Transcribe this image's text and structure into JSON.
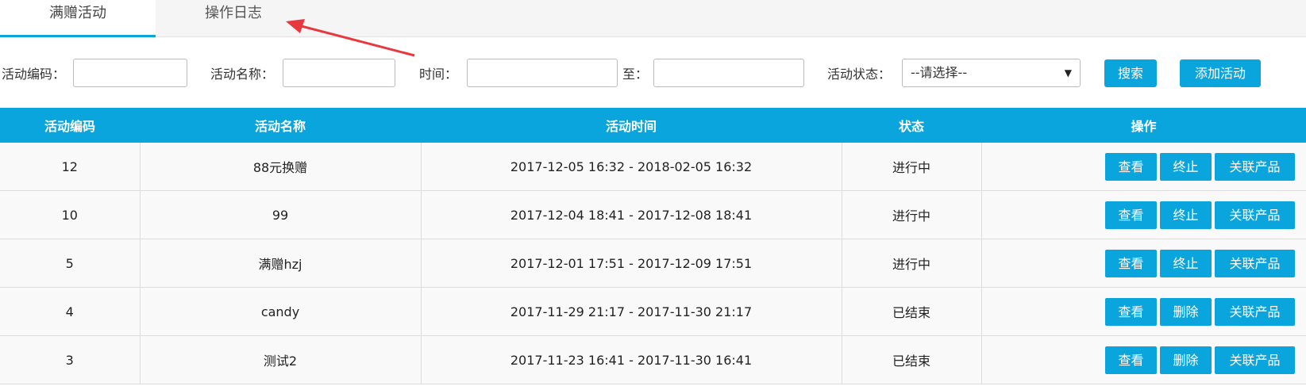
{
  "tabs": [
    {
      "label": "满赠活动",
      "active": true
    },
    {
      "label": "操作日志",
      "active": false
    }
  ],
  "filters": {
    "code_label": "活动编码：",
    "name_label": "活动名称：",
    "time_label": "时间：",
    "to_label": "至：",
    "status_label": "活动状态：",
    "status_selected": "--请选择--",
    "search_button": "搜索",
    "add_button": "添加活动"
  },
  "table": {
    "headers": [
      "活动编码",
      "活动名称",
      "活动时间",
      "状态",
      "操作"
    ],
    "rows": [
      {
        "code": "12",
        "name": "88元换赠",
        "time": "2017-12-05 16:32 - 2018-02-05 16:32",
        "status": "进行中",
        "actions": [
          "查看",
          "终止",
          "关联产品"
        ]
      },
      {
        "code": "10",
        "name": "99",
        "time": "2017-12-04 18:41 - 2017-12-08 18:41",
        "status": "进行中",
        "actions": [
          "查看",
          "终止",
          "关联产品"
        ]
      },
      {
        "code": "5",
        "name": "满赠hzj",
        "time": "2017-12-01 17:51 - 2017-12-09 17:51",
        "status": "进行中",
        "actions": [
          "查看",
          "终止",
          "关联产品"
        ]
      },
      {
        "code": "4",
        "name": "candy",
        "time": "2017-11-29 21:17 - 2017-11-30 21:17",
        "status": "已结束",
        "actions": [
          "查看",
          "删除",
          "关联产品"
        ]
      },
      {
        "code": "3",
        "name": "测试2",
        "time": "2017-11-23 16:41 - 2017-11-30 16:41",
        "status": "已结束",
        "actions": [
          "查看",
          "删除",
          "关联产品"
        ]
      }
    ]
  },
  "colors": {
    "accent": "#0aa5dd",
    "annotation_arrow": "#e8383d"
  }
}
